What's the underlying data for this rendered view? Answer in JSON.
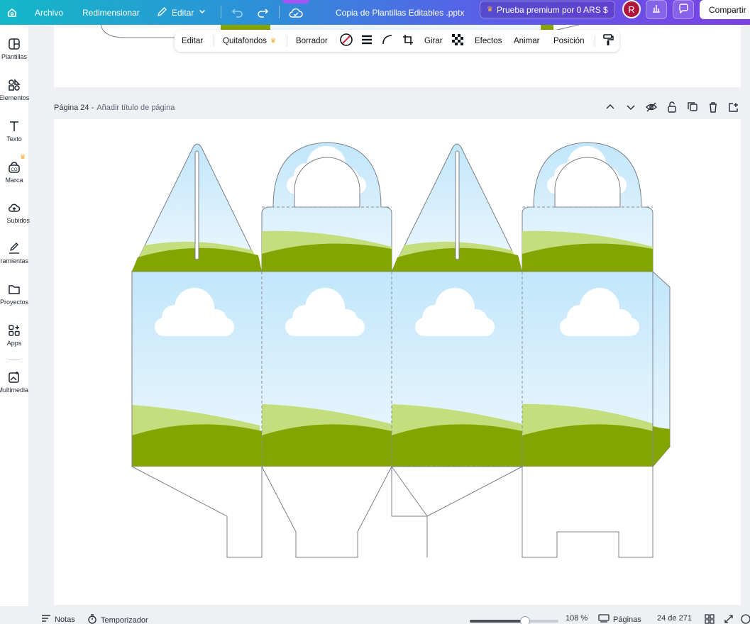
{
  "topbar": {
    "menu_archivo": "Archivo",
    "menu_redimensionar": "Redimensionar",
    "menu_editar": "Editar",
    "doc_title": "Copia de Plantillas Editables .pptx",
    "premium_label": "Prueba premium por 0 ARS $",
    "avatar_initial": "R",
    "share_label": "Compartir"
  },
  "sidebar": {
    "items": [
      {
        "label": "Plantillas",
        "icon": "templates-icon"
      },
      {
        "label": "Elementos",
        "icon": "elements-icon"
      },
      {
        "label": "Texto",
        "icon": "text-icon"
      },
      {
        "label": "Marca",
        "icon": "brand-icon"
      },
      {
        "label": "Subidos",
        "icon": "upload-icon"
      },
      {
        "label": "Herramientas",
        "icon": "draw-icon"
      },
      {
        "label": "Proyectos",
        "icon": "folder-icon"
      },
      {
        "label": "Apps",
        "icon": "apps-icon"
      },
      {
        "label": "Multimedia",
        "icon": "media-icon"
      }
    ]
  },
  "toolbar": {
    "editar": "Editar",
    "quitafondos": "Quitafondos",
    "borrador": "Borrador",
    "girar": "Girar",
    "efectos": "Efectos",
    "animar": "Animar",
    "posicion": "Posición"
  },
  "page": {
    "number_label": "Página 24 -",
    "title_placeholder": "Añadir título de página"
  },
  "status": {
    "notas": "Notas",
    "temporizador": "Temporizador",
    "zoom": "108 %",
    "zoom_fraction": 0.62,
    "paginas": "Páginas",
    "page_count": "24 de 271"
  },
  "colors": {
    "sky_top": "#c2e6fb",
    "sky_bottom": "#eef8fe",
    "hill_light": "#c4de7e",
    "hill_dark": "#84a402",
    "cloud": "#ffffff",
    "accent_purple": "#7b3fe4"
  }
}
